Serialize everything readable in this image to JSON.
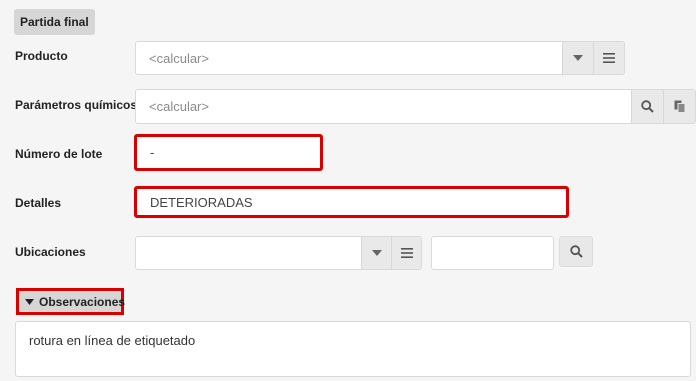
{
  "section": {
    "title": "Partida final"
  },
  "fields": {
    "producto": {
      "label": "Producto",
      "placeholder": "<calcular>"
    },
    "parametros": {
      "label": "Parámetros químicos",
      "placeholder": "<calcular>"
    },
    "lote": {
      "label": "Número de lote",
      "value": "-"
    },
    "detalles": {
      "label": "Detalles",
      "value": "DETERIORADAS"
    },
    "ubicaciones": {
      "label": "Ubicaciones",
      "value": "",
      "value2": ""
    }
  },
  "observaciones": {
    "label": "Observaciones",
    "text": "rotura en línea de etiquetado"
  },
  "icons": {
    "dropdown": "caret-down-icon",
    "list": "list-icon",
    "search": "search-icon",
    "copy": "copy-icon",
    "expand": "caret-down-icon"
  },
  "colors": {
    "highlight": "#d90000"
  }
}
